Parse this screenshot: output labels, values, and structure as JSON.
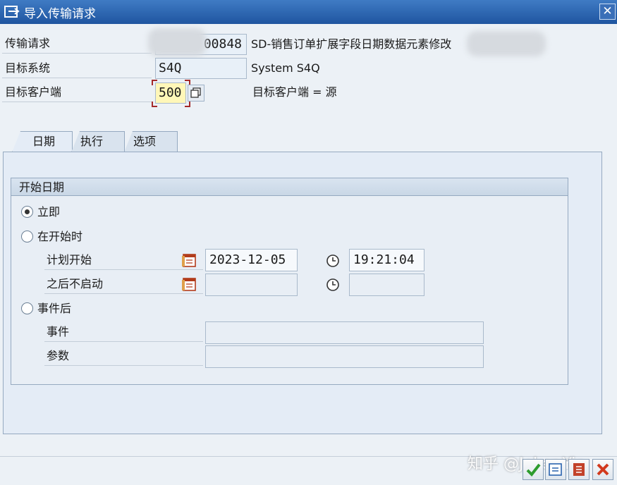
{
  "window": {
    "title": "导入传输请求",
    "close_glyph": "✕"
  },
  "header_fields": {
    "request": {
      "label": "传输请求",
      "value": "00848",
      "description": "SD-销售订单扩展字段日期数据元素修改"
    },
    "target_system": {
      "label": "目标系统",
      "value": "S4Q",
      "description": "System S4Q"
    },
    "target_client": {
      "label": "目标客户端",
      "value": "500",
      "description": "目标客户端 = 源"
    }
  },
  "tabs": [
    {
      "label": "日期",
      "active": true
    },
    {
      "label": "执行",
      "active": false
    },
    {
      "label": "选项",
      "active": false
    }
  ],
  "start_date_group": {
    "title": "开始日期",
    "options": [
      {
        "label": "立即",
        "selected": true
      },
      {
        "label": "在开始时",
        "selected": false
      },
      {
        "label": "事件后",
        "selected": false
      }
    ],
    "planned_start": {
      "label": "计划开始",
      "date": "2023-12-05",
      "time": "19:21:04"
    },
    "no_start_after": {
      "label": "之后不启动",
      "date": "",
      "time": ""
    },
    "event": {
      "label": "事件",
      "value": ""
    },
    "parameter": {
      "label": "参数",
      "value": ""
    }
  },
  "watermark": "知乎 @Joker Yin",
  "icons": {
    "title": "import-icon",
    "value_help": "value-help-icon",
    "calendar": "calendar-icon",
    "clock": "clock-icon",
    "confirm": "check-icon",
    "schedule": "schedule-icon",
    "import_all": "import-all-icon",
    "cancel": "cancel-icon"
  },
  "colors": {
    "titlebar": "#2a63ae",
    "focused_field": "#fff7b8",
    "confirm_green": "#2e9c2e",
    "cancel_red": "#d23a1e"
  }
}
